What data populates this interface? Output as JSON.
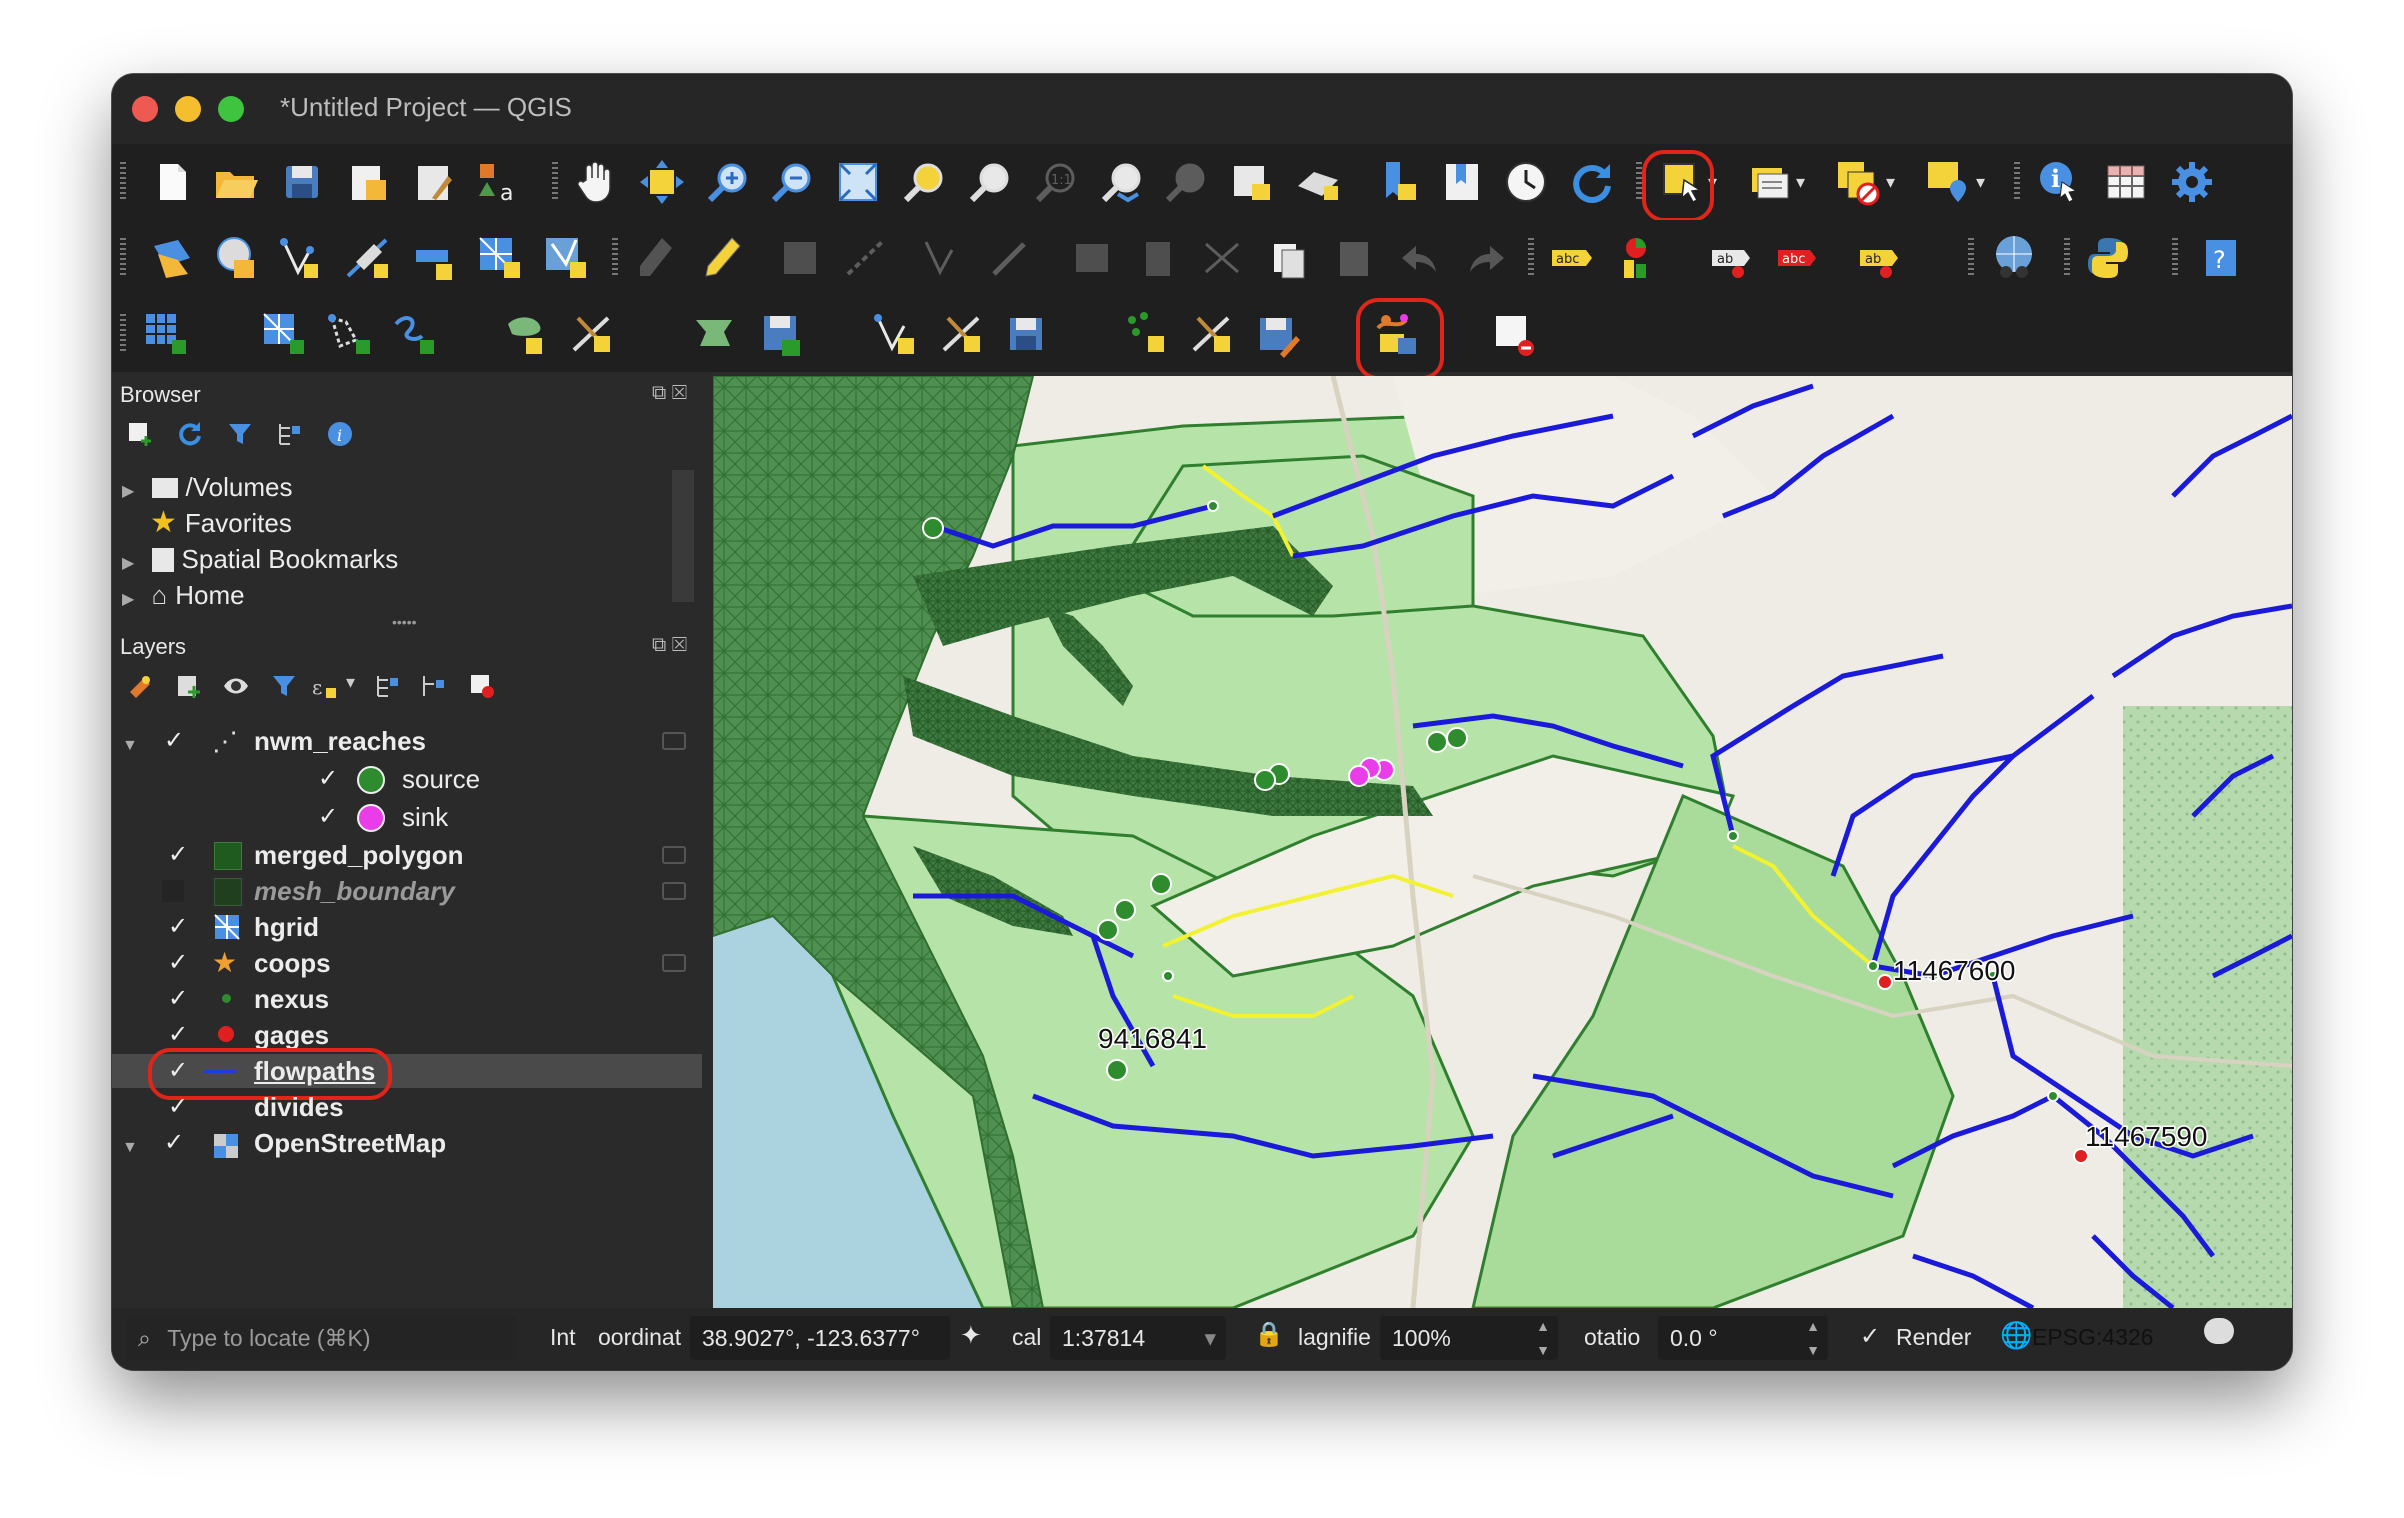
{
  "window": {
    "title": "*Untitled Project — QGIS"
  },
  "toolbars": {
    "row1_icons": [
      "new-project-icon",
      "open-project-icon",
      "save-project-icon",
      "new-print-layout-icon",
      "layout-manager-icon",
      "style-manager-icon",
      "pan-icon",
      "pan-to-selection-icon",
      "zoom-in-icon",
      "zoom-out-icon",
      "zoom-full-icon",
      "zoom-to-selection-icon",
      "zoom-to-layer-icon",
      "zoom-native-icon",
      "zoom-last-icon",
      "zoom-next-icon",
      "new-map-view-icon",
      "new-3d-map-icon",
      "new-spatial-bookmark-icon",
      "show-bookmarks-icon",
      "temporal-controller-icon",
      "refresh-icon",
      "select-features-icon",
      "select-by-attribute-icon",
      "deselect-icon",
      "select-by-location-icon",
      "identify-icon",
      "attribute-table-icon",
      "settings-icon"
    ],
    "row2_icons": [
      "data-source-manager-icon",
      "new-geopackage-icon",
      "add-vector-icon",
      "add-raster-icon",
      "digitize-icon",
      "save-edits-icon",
      "label-tool-icon",
      "python-icon",
      "help-icon"
    ],
    "row3_icons": [
      "mesh-icon",
      "mesh-edit-icon",
      "mesh-export-icon"
    ]
  },
  "browser": {
    "title": "Browser",
    "items": [
      {
        "label": "/Volumes",
        "icon": "folder-icon"
      },
      {
        "label": "Favorites",
        "icon": "star-icon"
      },
      {
        "label": "Spatial Bookmarks",
        "icon": "bookmark-icon"
      },
      {
        "label": "Home",
        "icon": "home-icon"
      }
    ]
  },
  "layers": {
    "title": "Layers",
    "items": [
      {
        "label": "nwm_reaches",
        "bold": true
      },
      {
        "label": "source",
        "bold": false,
        "color": "#2e8b2e"
      },
      {
        "label": "sink",
        "bold": false,
        "color": "#e83de8"
      },
      {
        "label": "merged_polygon",
        "bold": true,
        "color": "#1f5a1f"
      },
      {
        "label": "mesh_boundary",
        "bold": true,
        "italic": true,
        "color": "#1f5a1f"
      },
      {
        "label": "hgrid",
        "bold": true
      },
      {
        "label": "coops",
        "bold": true,
        "color": "#f0a030"
      },
      {
        "label": "nexus",
        "bold": true,
        "color": "#2e8b2e"
      },
      {
        "label": "gages",
        "bold": true,
        "color": "#e02020"
      },
      {
        "label": "flowpaths",
        "bold": true,
        "color": "#1a3ce0"
      },
      {
        "label": "divides",
        "bold": true
      },
      {
        "label": "OpenStreetMap",
        "bold": true
      }
    ]
  },
  "map": {
    "labels": {
      "gage_a": "9416841",
      "gage_b": "11467600",
      "gage_c": "11467590"
    },
    "colors": {
      "flowpath": "#1a1ad8",
      "nwm_reach": "#f2f230",
      "mesh": "#2f6f2f",
      "divide": "#b6e3a8",
      "gage": "#e02020",
      "nexus": "#2e8b2e",
      "sink": "#e83de8"
    }
  },
  "status": {
    "search_placeholder": "Type to locate (⌘K)",
    "int_label": "Int",
    "coordinate_label": "oordinat",
    "coordinate_value": "38.9027°, -123.6377°",
    "scale_label": "cal",
    "scale_value": "1:37814",
    "magnifier_label": "lagnifie",
    "magnifier_value": "100%",
    "rotation_label": "otatio",
    "rotation_value": "0.0 °",
    "render_label": "Render",
    "crs_value": "EPSG:4326"
  }
}
